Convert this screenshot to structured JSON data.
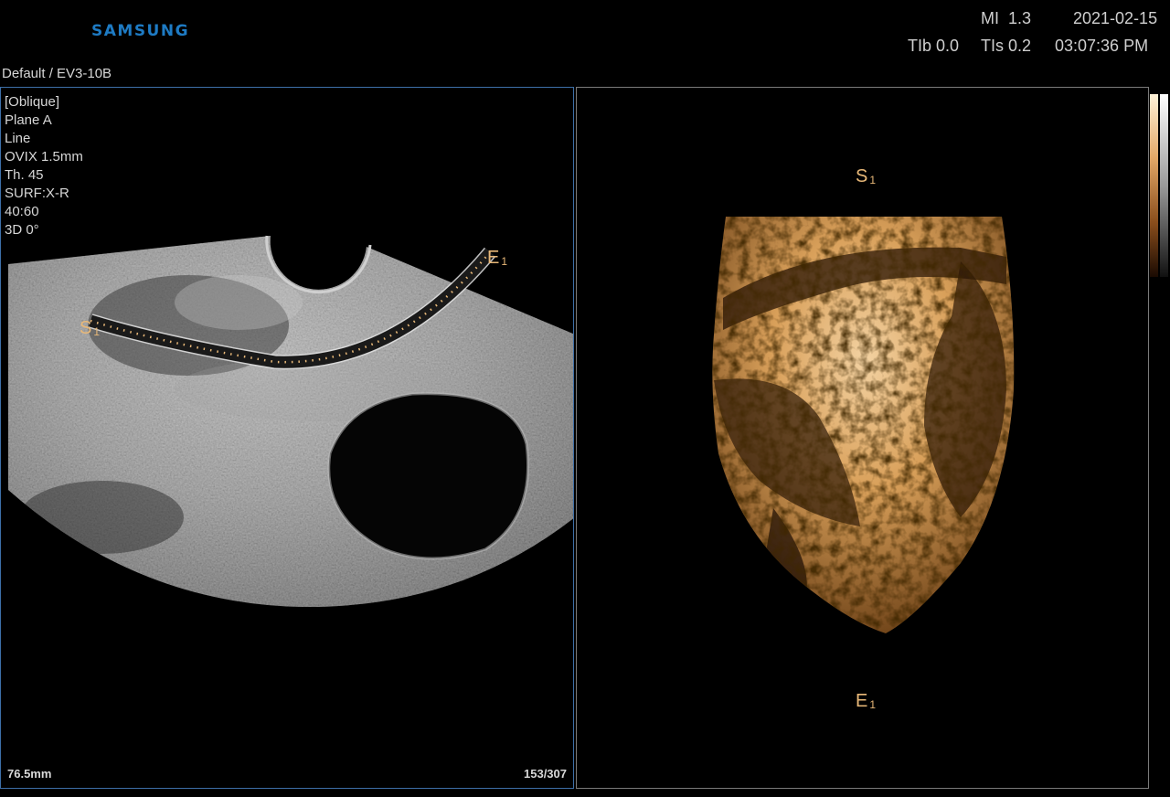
{
  "header": {
    "brand": "SAMSUNG",
    "mi_label": "MI",
    "mi_value": "1.3",
    "tib_label": "TIb",
    "tib_value": "0.0",
    "tis_label": "TIs",
    "tis_value": "0.2",
    "date": "2021-02-15",
    "time": "03:07:36 PM",
    "preset": "Default / EV3-10B"
  },
  "left_panel": {
    "params": [
      "[Oblique]",
      "Plane A",
      "Line",
      "OVIX 1.5mm",
      "Th. 45",
      "SURF:X-R",
      "40:60",
      "3D 0°"
    ],
    "depth": "76.5mm",
    "frame": "153/307",
    "start_marker": "S",
    "end_marker": "E",
    "marker_index": "1"
  },
  "right_panel": {
    "start_marker": "S",
    "end_marker": "E",
    "marker_index": "1"
  },
  "colors": {
    "brand": "#1e7bc4",
    "panel_border": "#3d6fa8",
    "right_border": "#7a7a7a",
    "marker": "#e8b878",
    "render_tint": "#d9a05a"
  }
}
